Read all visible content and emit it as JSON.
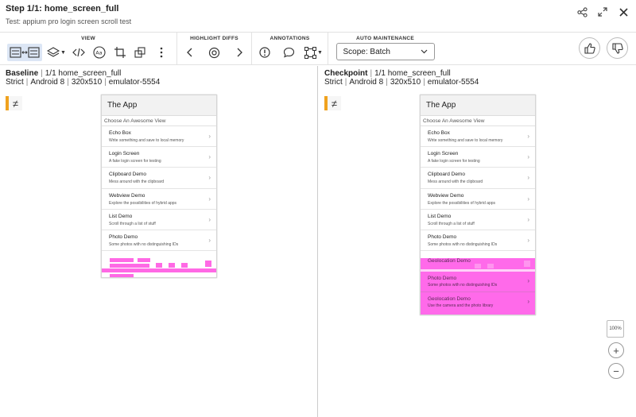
{
  "header": {
    "title": "Step 1/1: home_screen_full",
    "subtitle": "Test: appium pro login screen scroll test",
    "icons": [
      "share-icon",
      "expand-icon",
      "close-icon"
    ]
  },
  "toolbar": {
    "view_label": "VIEW",
    "highlight_label": "HIGHLIGHT DIFFS",
    "annotations_label": "ANNOTATIONS",
    "auto_maintenance_label": "AUTO MAINTENANCE",
    "scope_value": "Scope: Batch",
    "accent_color": "#dce6f5"
  },
  "baseline": {
    "label": "Baseline",
    "step": "1/1 home_screen_full",
    "match_level": "Strict",
    "os": "Android 8",
    "resolution": "320x510",
    "device": "emulator-5554"
  },
  "checkpoint": {
    "label": "Checkpoint",
    "step": "1/1 home_screen_full",
    "match_level": "Strict",
    "os": "Android 8",
    "resolution": "320x510",
    "device": "emulator-5554"
  },
  "status": {
    "symbol": "≠",
    "color": "#f0a21e"
  },
  "app": {
    "title": "The App",
    "section": "Choose An Awesome View",
    "items": [
      {
        "title": "Echo Box",
        "subtitle": "Write something and save to local memory"
      },
      {
        "title": "Login Screen",
        "subtitle": "A fake login screen for testing"
      },
      {
        "title": "Clipboard Demo",
        "subtitle": "Mess around with the clipboard"
      },
      {
        "title": "Webview Demo",
        "subtitle": "Explore the possibilities of hybrid apps"
      },
      {
        "title": "List Demo",
        "subtitle": "Scroll through a list of stuff"
      },
      {
        "title": "Photo Demo",
        "subtitle": "Some photos with no distinguishing IDs"
      }
    ],
    "checkpoint_extra": [
      {
        "title": "Geolocation Demo",
        "subtitle": ""
      },
      {
        "title": "Photo Demo",
        "subtitle": "Some photos with no distinguishing IDs"
      },
      {
        "title": "Geolocation Demo",
        "subtitle": "Use the camera and the photo library"
      }
    ],
    "diff_color": "#ff4fe0"
  },
  "zoom": {
    "fit_label": "100%",
    "zoom_in": "+",
    "zoom_out": "−"
  }
}
